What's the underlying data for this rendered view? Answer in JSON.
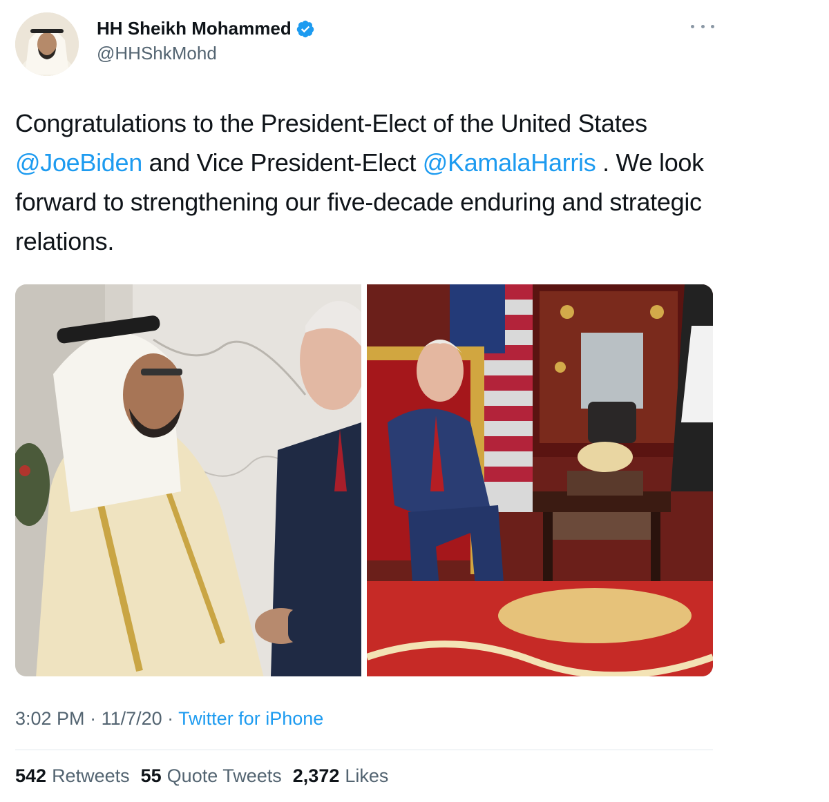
{
  "author": {
    "display_name": "HH Sheikh Mohammed",
    "handle": "@HHShkMohd",
    "verified_icon": "verified-badge-icon"
  },
  "menu_icon": "more-dots-icon",
  "tweet": {
    "text_1": "Congratulations to the President-Elect of the United States ",
    "mention_1": "@JoeBiden",
    "text_2": " and Vice President-Elect ",
    "mention_2": "@KamalaHarris",
    "text_3": " . We look forward to strengthening our five-decade enduring and strategic relations."
  },
  "meta": {
    "time": "3:02 PM",
    "separator": " · ",
    "date": "11/7/20",
    "source": "Twitter for iPhone"
  },
  "stats": {
    "retweets_count": "542",
    "retweets_label": "Retweets",
    "quotes_count": "55",
    "quotes_label": "Quote Tweets",
    "likes_count": "2,372",
    "likes_label": "Likes"
  },
  "colors": {
    "link": "#1d9bf0",
    "secondary_text": "#536471",
    "primary_text": "#0f1419",
    "divider": "#e1e8ed"
  }
}
